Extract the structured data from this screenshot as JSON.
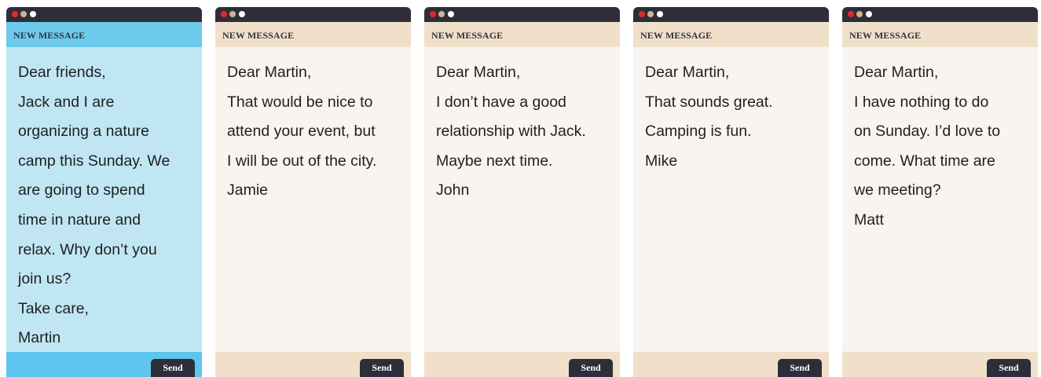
{
  "colors": {
    "titlebar": "#2d2e3a",
    "dot_red": "#e3262b",
    "dot_tan": "#cdb48f",
    "dot_white": "#ffffff",
    "blue_header": "#6dcaeb",
    "blue_body": "#c0e6f4",
    "beige_header": "#f1e0c9",
    "beige_body": "#f9f4ef"
  },
  "windows": [
    {
      "theme": "blue",
      "header": "NEW MESSAGE",
      "lines": [
        "Dear friends,",
        "Jack and I are",
        "organizing a nature",
        "camp this Sunday. We",
        "are going to spend",
        "time in nature and",
        "relax. Why don’t you",
        "join us?",
        "Take care,",
        "Martin"
      ],
      "send": "Send"
    },
    {
      "theme": "beige",
      "header": "NEW MESSAGE",
      "lines": [
        "Dear Martin,",
        "That would be nice to",
        "attend your event, but",
        "I will be out of the city.",
        "Jamie"
      ],
      "send": "Send"
    },
    {
      "theme": "beige",
      "header": "NEW MESSAGE",
      "lines": [
        "Dear Martin,",
        "I don’t have a good",
        "relationship with Jack.",
        "Maybe next time.",
        "John"
      ],
      "send": "Send"
    },
    {
      "theme": "beige",
      "header": "NEW MESSAGE",
      "lines": [
        "Dear Martin,",
        "That sounds great.",
        "Camping is fun.",
        "Mike"
      ],
      "send": "Send"
    },
    {
      "theme": "beige",
      "header": "NEW MESSAGE",
      "lines": [
        "Dear Martin,",
        "I have nothing to do",
        "on Sunday. I’d love to",
        "come. What time are",
        "we meeting?",
        "Matt"
      ],
      "send": "Send"
    }
  ]
}
